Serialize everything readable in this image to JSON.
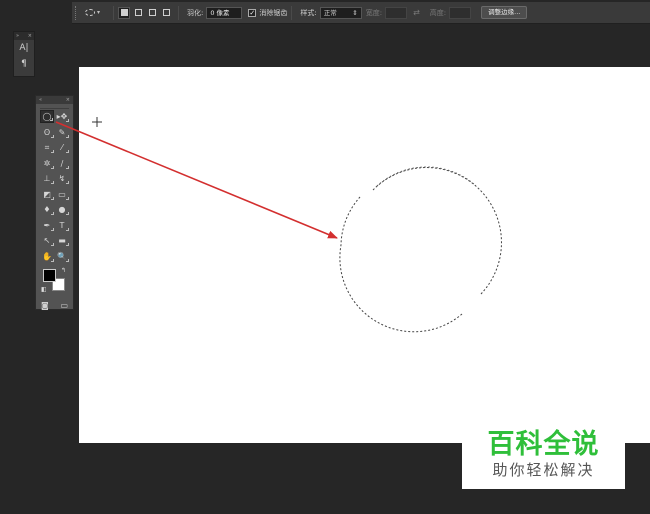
{
  "options_bar": {
    "tool_icon": "elliptical-marquee-icon",
    "selection_modes": [
      "new-selection-icon",
      "add-to-selection-icon",
      "subtract-from-selection-icon",
      "intersect-selection-icon"
    ],
    "feather_label": "羽化:",
    "feather_value": "0 像素",
    "antialias_label": "消除锯齿",
    "antialias_checked": true,
    "style_label": "样式:",
    "style_value": "正常",
    "width_label": "宽度:",
    "height_label": "高度:",
    "swap_icon": "swap-dimensions-icon",
    "refine_edge_label": "调整边缘..."
  },
  "mini_panel": {
    "icons": [
      "A|",
      "¶"
    ],
    "icon_names": [
      "character-panel-icon",
      "paragraph-panel-icon"
    ]
  },
  "toolbox": {
    "rows": [
      [
        {
          "name": "elliptical-marquee-icon",
          "glyph": "◯",
          "active": true
        },
        {
          "name": "move-icon",
          "glyph": "▸✥"
        }
      ],
      [
        {
          "name": "lasso-icon",
          "glyph": "ʘ"
        },
        {
          "name": "quick-selection-icon",
          "glyph": "✎"
        }
      ],
      [
        {
          "name": "crop-icon",
          "glyph": "⌗"
        },
        {
          "name": "eyedropper-icon",
          "glyph": "⁄"
        }
      ],
      [
        {
          "name": "healing-brush-icon",
          "glyph": "✲"
        },
        {
          "name": "brush-icon",
          "glyph": "∕"
        }
      ],
      [
        {
          "name": "clone-stamp-icon",
          "glyph": "⊥"
        },
        {
          "name": "history-brush-icon",
          "glyph": "↯"
        }
      ],
      [
        {
          "name": "eraser-icon",
          "glyph": "◩"
        },
        {
          "name": "gradient-icon",
          "glyph": "▭"
        }
      ],
      [
        {
          "name": "blur-icon",
          "glyph": "♦"
        },
        {
          "name": "dodge-icon",
          "glyph": "●"
        }
      ],
      [
        {
          "name": "pen-icon",
          "glyph": "✒"
        },
        {
          "name": "type-icon",
          "glyph": "T"
        }
      ],
      [
        {
          "name": "path-selection-icon",
          "glyph": "↖"
        },
        {
          "name": "rectangle-shape-icon",
          "glyph": "▬"
        }
      ],
      [
        {
          "name": "hand-icon",
          "glyph": "✋"
        },
        {
          "name": "zoom-icon",
          "glyph": "🔍"
        }
      ]
    ],
    "foreground_color": "#000000",
    "background_color": "#ffffff",
    "bottom_icons": [
      "quick-mask-icon",
      "screen-mode-icon"
    ]
  },
  "watermark": {
    "title": "百科全说",
    "subtitle": "助你轻松解决"
  },
  "colors": {
    "annotation_arrow": "#d32f2f",
    "canvas": "#ffffff",
    "workspace": "#262626",
    "watermark_green": "#2fbf3a"
  }
}
